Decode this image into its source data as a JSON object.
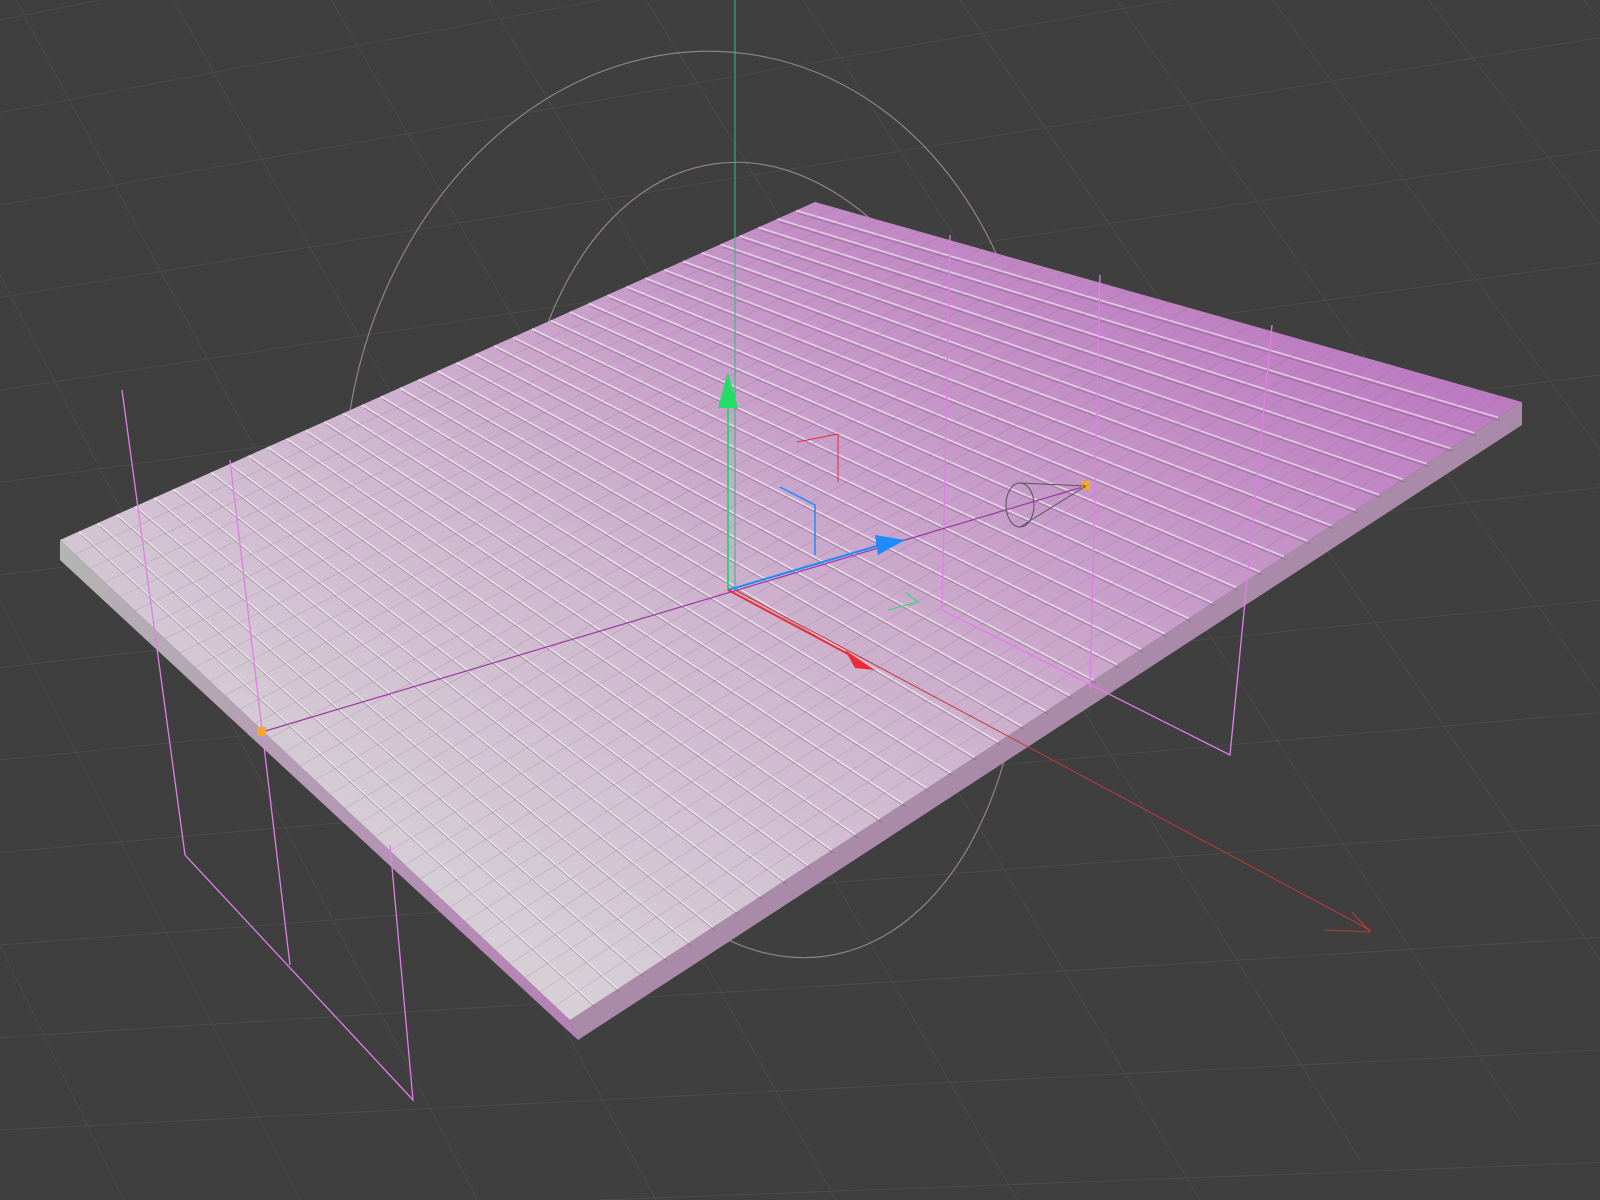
{
  "viewport": {
    "background_color": "#3f3f3f",
    "grid_color": "#4d4d4d",
    "object_gradient_start": "#d6d6d6",
    "object_gradient_end": "#c07cc4",
    "selection_outline_color": "#e07ee6",
    "handle_color": "#f0a830",
    "spline_color": "#9a8a90"
  },
  "gizmo": {
    "x_axis_color": "#ee2a36",
    "y_axis_color": "#22dd66",
    "z_axis_color": "#1e8cff",
    "icons": [
      "move-x-arrow-icon",
      "move-y-arrow-icon",
      "move-z-arrow-icon",
      "camera-cone-icon"
    ]
  }
}
